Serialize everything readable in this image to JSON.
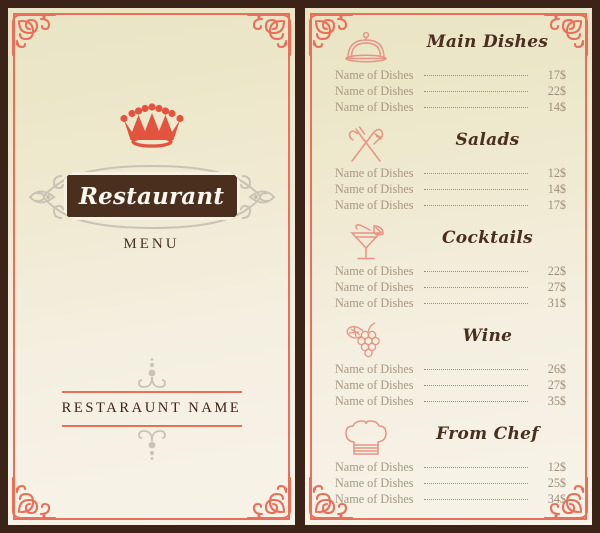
{
  "colors": {
    "background": "#3b2317",
    "paper": "#efeadb",
    "accent": "#e8705a",
    "dark_brown": "#4a2e1e",
    "dish_text": "#a79781",
    "price_text": "#9e8e79",
    "ornament_gray": "#c9c3b6"
  },
  "left_panel": {
    "logo_icon": "crown-icon",
    "banner_title": "Restaurant",
    "subtitle": "MENU",
    "footer_name": "RESTARAUNT NAME",
    "divider_icon": "flourish-ornament"
  },
  "right_panel": {
    "sections": [
      {
        "title": "Main Dishes",
        "icon": "cloche-icon",
        "items": [
          {
            "name": "Name of Dishes",
            "price": "17$"
          },
          {
            "name": "Name of Dishes",
            "price": "22$"
          },
          {
            "name": "Name of Dishes",
            "price": "14$"
          }
        ]
      },
      {
        "title": "Salads",
        "icon": "fork-knife-icon",
        "items": [
          {
            "name": "Name of Dishes",
            "price": "12$"
          },
          {
            "name": "Name of Dishes",
            "price": "14$"
          },
          {
            "name": "Name of Dishes",
            "price": "17$"
          }
        ]
      },
      {
        "title": "Cocktails",
        "icon": "cocktail-glass-icon",
        "items": [
          {
            "name": "Name of Dishes",
            "price": "22$"
          },
          {
            "name": "Name of Dishes",
            "price": "27$"
          },
          {
            "name": "Name of Dishes",
            "price": "31$"
          }
        ]
      },
      {
        "title": "Wine",
        "icon": "grapes-icon",
        "items": [
          {
            "name": "Name of Dishes",
            "price": "26$"
          },
          {
            "name": "Name of Dishes",
            "price": "27$"
          },
          {
            "name": "Name of Dishes",
            "price": "35$"
          }
        ]
      },
      {
        "title": "From Chef",
        "icon": "chef-hat-icon",
        "items": [
          {
            "name": "Name of Dishes",
            "price": "12$"
          },
          {
            "name": "Name of Dishes",
            "price": "25$"
          },
          {
            "name": "Name of Dishes",
            "price": "34$"
          }
        ]
      }
    ]
  }
}
